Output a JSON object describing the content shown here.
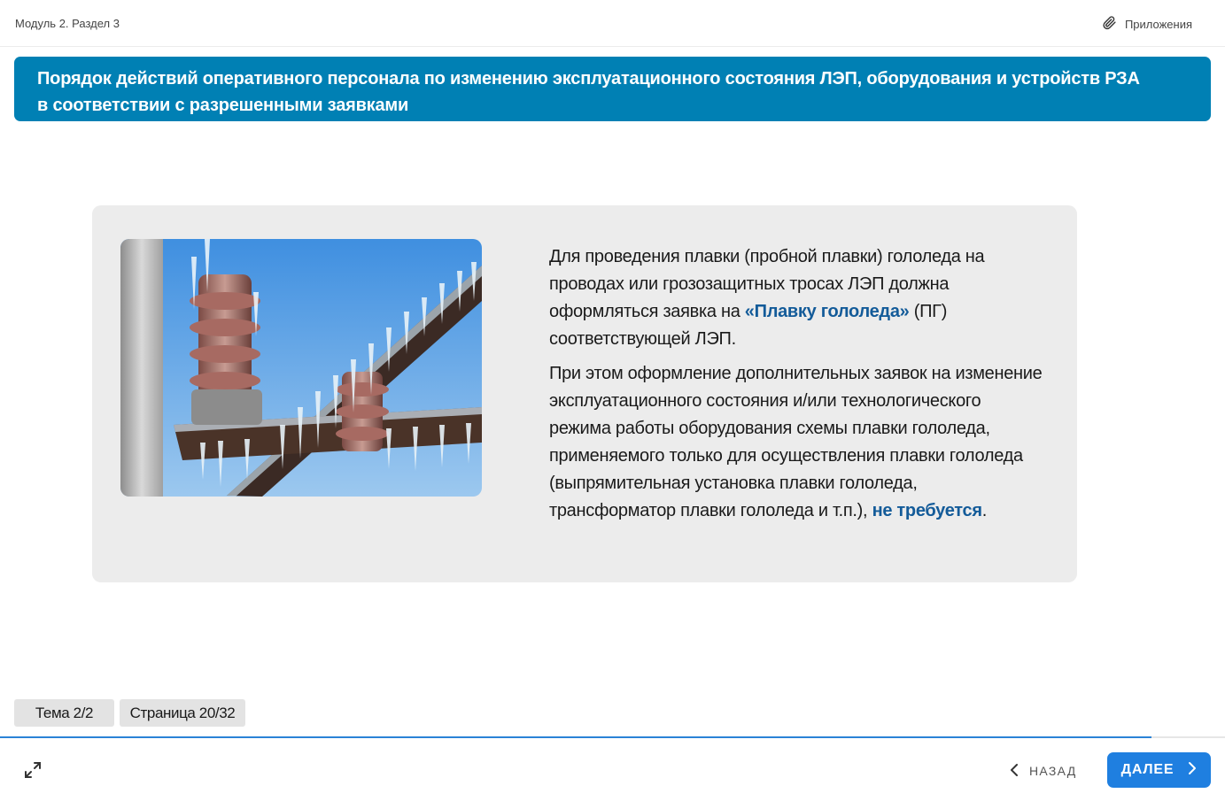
{
  "header": {
    "breadcrumb": "Модуль 2. Раздел 3",
    "attachments_label": "Приложения"
  },
  "title": {
    "line1": "Порядок действий оперативного персонала по изменению эксплуатационного состояния ЛЭП, оборудования и устройств РЗА",
    "line2": "в соответствии с разрешенными заявками"
  },
  "content": {
    "image_icon": "iced-insulators-photo",
    "p1_before": "Для проведения плавки (пробной плавки) гололеда на проводах или грозозащитных тросах ЛЭП должна оформляться заявка на ",
    "p1_highlight": "«Плавку гололеда»",
    "p1_after": " (ПГ) соответствующей ЛЭП.",
    "p2_before": "При этом оформление дополнительных заявок на изменение эксплуатационного состояния и/или технологического режима работы оборудования схемы плавки гололеда, применяемого только для осуществления плавки гололеда (выпрямительная установка плавки гололеда, трансформатор плавки гололеда и т.п.), ",
    "p2_highlight": "не требуется",
    "p2_after": "."
  },
  "footer": {
    "topic_label": "Тема 2/2",
    "page_label": "Страница 20/32",
    "progress": 0.94,
    "back_label": "НАЗАД",
    "next_label": "ДАЛЕЕ"
  },
  "colors": {
    "banner": "#0080b4",
    "highlight": "#135b99",
    "next_button": "#1f7fe0",
    "card": "#ececec"
  }
}
